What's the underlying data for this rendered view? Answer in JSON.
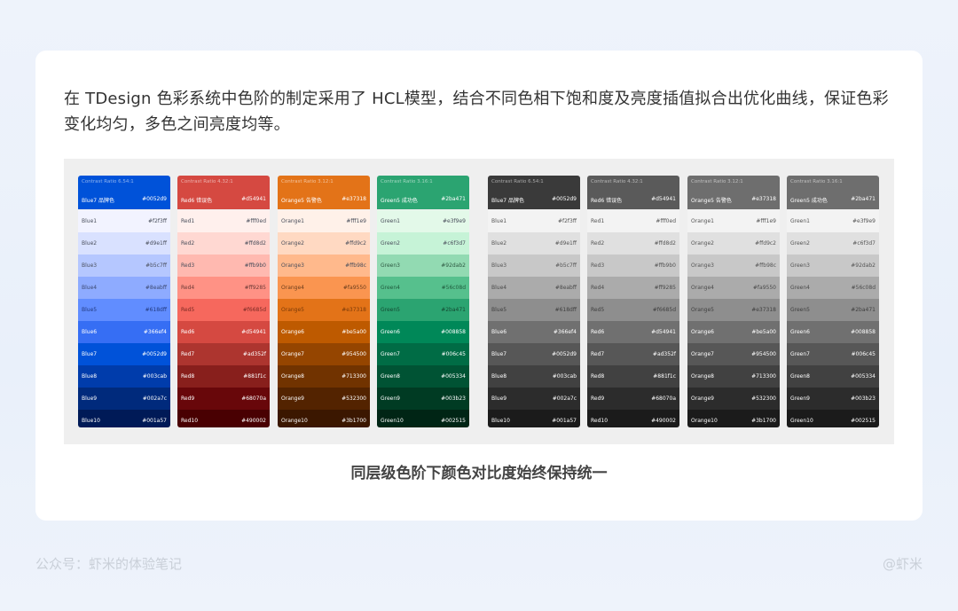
{
  "intro_text": "在 TDesign 色彩系统中色阶的制定采用了 HCL模型，结合不同色相下饱和度及亮度插值拟合出优化曲线，保证色彩变化均匀，多色之间亮度均等。",
  "caption": "同层级色阶下颜色对比度始终保持统一",
  "footer": {
    "left": "公众号：虾米的体验笔记",
    "right": "@虾米"
  },
  "palettes": [
    {
      "ratio": "Contrast Ratio 6.54:1",
      "subtitle": "Blue7 品牌色",
      "hex": "#0052d9",
      "header_color": "#0052d9",
      "rows": [
        {
          "name": "Blue1",
          "hex": "#f2f3ff",
          "bg": "#f2f3ff",
          "fg": "#4a4f5c"
        },
        {
          "name": "Blue2",
          "hex": "#d9e1ff",
          "bg": "#d9e1ff",
          "fg": "#4a4f5c"
        },
        {
          "name": "Blue3",
          "hex": "#b5c7ff",
          "bg": "#b5c7ff",
          "fg": "#4a4f5c"
        },
        {
          "name": "Blue4",
          "hex": "#8eabff",
          "bg": "#8eabff",
          "fg": "#3d4a73"
        },
        {
          "name": "Blue5",
          "hex": "#618dff",
          "bg": "#618dff",
          "fg": "#223a80"
        },
        {
          "name": "Blue6",
          "hex": "#366ef4",
          "bg": "#366ef4",
          "fg": "#ffffff"
        },
        {
          "name": "Blue7",
          "hex": "#0052d9",
          "bg": "#0052d9",
          "fg": "#ffffff"
        },
        {
          "name": "Blue8",
          "hex": "#003cab",
          "bg": "#003cab",
          "fg": "#ffffff"
        },
        {
          "name": "Blue9",
          "hex": "#002a7c",
          "bg": "#002a7c",
          "fg": "#ffffff"
        },
        {
          "name": "Blue10",
          "hex": "#001a57",
          "bg": "#001a57",
          "fg": "#ffffff"
        }
      ]
    },
    {
      "ratio": "Contrast Ratio 4.32:1",
      "subtitle": "Red6 错误色",
      "hex": "#d54941",
      "header_color": "#d54941",
      "rows": [
        {
          "name": "Red1",
          "hex": "#fff0ed",
          "bg": "#fff0ed",
          "fg": "#4a4f5c"
        },
        {
          "name": "Red2",
          "hex": "#ffd8d2",
          "bg": "#ffd8d2",
          "fg": "#4a4f5c"
        },
        {
          "name": "Red3",
          "hex": "#ffb9b0",
          "bg": "#ffb9b0",
          "fg": "#4a4f5c"
        },
        {
          "name": "Red4",
          "hex": "#ff9285",
          "bg": "#ff9285",
          "fg": "#6b3a36"
        },
        {
          "name": "Red5",
          "hex": "#f6685d",
          "bg": "#f6685d",
          "fg": "#7a2a24"
        },
        {
          "name": "Red6",
          "hex": "#d54941",
          "bg": "#d54941",
          "fg": "#ffffff"
        },
        {
          "name": "Red7",
          "hex": "#ad352f",
          "bg": "#ad352f",
          "fg": "#ffffff"
        },
        {
          "name": "Red8",
          "hex": "#881f1c",
          "bg": "#881f1c",
          "fg": "#ffffff"
        },
        {
          "name": "Red9",
          "hex": "#68070a",
          "bg": "#68070a",
          "fg": "#ffffff"
        },
        {
          "name": "Red10",
          "hex": "#490002",
          "bg": "#490002",
          "fg": "#ffffff"
        }
      ]
    },
    {
      "ratio": "Contrast Ratio 3.12:1",
      "subtitle": "Orange5 告警色",
      "hex": "#e37318",
      "header_color": "#e37318",
      "rows": [
        {
          "name": "Orange1",
          "hex": "#fff1e9",
          "bg": "#fff1e9",
          "fg": "#4a4f5c"
        },
        {
          "name": "Orange2",
          "hex": "#ffd9c2",
          "bg": "#ffd9c2",
          "fg": "#4a4f5c"
        },
        {
          "name": "Orange3",
          "hex": "#ffb98c",
          "bg": "#ffb98c",
          "fg": "#4a4f5c"
        },
        {
          "name": "Orange4",
          "hex": "#fa9550",
          "bg": "#fa9550",
          "fg": "#6b3d1c"
        },
        {
          "name": "Orange5",
          "hex": "#e37318",
          "bg": "#e37318",
          "fg": "#7a3a08"
        },
        {
          "name": "Orange6",
          "hex": "#be5a00",
          "bg": "#be5a00",
          "fg": "#ffffff"
        },
        {
          "name": "Orange7",
          "hex": "#954500",
          "bg": "#954500",
          "fg": "#ffffff"
        },
        {
          "name": "Orange8",
          "hex": "#713300",
          "bg": "#713300",
          "fg": "#ffffff"
        },
        {
          "name": "Orange9",
          "hex": "#532300",
          "bg": "#532300",
          "fg": "#ffffff"
        },
        {
          "name": "Orange10",
          "hex": "#3b1700",
          "bg": "#3b1700",
          "fg": "#ffffff"
        }
      ]
    },
    {
      "ratio": "Contrast Ratio 3.16:1",
      "subtitle": "Green5 成功色",
      "hex": "#2ba471",
      "header_color": "#2ba471",
      "rows": [
        {
          "name": "Green1",
          "hex": "#e3f9e9",
          "bg": "#e3f9e9",
          "fg": "#4a4f5c"
        },
        {
          "name": "Green2",
          "hex": "#c6f3d7",
          "bg": "#c6f3d7",
          "fg": "#4a4f5c"
        },
        {
          "name": "Green3",
          "hex": "#92dab2",
          "bg": "#92dab2",
          "fg": "#2f5a43"
        },
        {
          "name": "Green4",
          "hex": "#56c08d",
          "bg": "#56c08d",
          "fg": "#1f5a3d"
        },
        {
          "name": "Green5",
          "hex": "#2ba471",
          "bg": "#2ba471",
          "fg": "#134a32"
        },
        {
          "name": "Green6",
          "hex": "#008858",
          "bg": "#008858",
          "fg": "#ffffff"
        },
        {
          "name": "Green7",
          "hex": "#006c45",
          "bg": "#006c45",
          "fg": "#ffffff"
        },
        {
          "name": "Green8",
          "hex": "#005334",
          "bg": "#005334",
          "fg": "#ffffff"
        },
        {
          "name": "Green9",
          "hex": "#003b23",
          "bg": "#003b23",
          "fg": "#ffffff"
        },
        {
          "name": "Green10",
          "hex": "#002515",
          "bg": "#002515",
          "fg": "#ffffff"
        }
      ]
    },
    {
      "ratio": "Contrast Ratio 6.54:1",
      "subtitle": "Blue7 品牌色",
      "hex": "#0052d9",
      "header_color": "#3a3a3a",
      "rows": [
        {
          "name": "Blue1",
          "hex": "#f2f3ff",
          "bg": "#f3f3f3",
          "fg": "#555555"
        },
        {
          "name": "Blue2",
          "hex": "#d9e1ff",
          "bg": "#e0e0e0",
          "fg": "#555555"
        },
        {
          "name": "Blue3",
          "hex": "#b5c7ff",
          "bg": "#c8c8c8",
          "fg": "#555555"
        },
        {
          "name": "Blue4",
          "hex": "#8eabff",
          "bg": "#ababab",
          "fg": "#4a4a4a"
        },
        {
          "name": "Blue5",
          "hex": "#618dff",
          "bg": "#8e8e8e",
          "fg": "#3f3f3f"
        },
        {
          "name": "Blue6",
          "hex": "#366ef4",
          "bg": "#707070",
          "fg": "#ffffff"
        },
        {
          "name": "Blue7",
          "hex": "#0052d9",
          "bg": "#575757",
          "fg": "#ffffff"
        },
        {
          "name": "Blue8",
          "hex": "#003cab",
          "bg": "#414141",
          "fg": "#ffffff"
        },
        {
          "name": "Blue9",
          "hex": "#002a7c",
          "bg": "#2c2c2c",
          "fg": "#ffffff"
        },
        {
          "name": "Blue10",
          "hex": "#001a57",
          "bg": "#1b1b1b",
          "fg": "#ffffff"
        }
      ]
    },
    {
      "ratio": "Contrast Ratio 4.32:1",
      "subtitle": "Red6 错误色",
      "hex": "#d54941",
      "header_color": "#5a5a5a",
      "rows": [
        {
          "name": "Red1",
          "hex": "#fff0ed",
          "bg": "#f3f3f3",
          "fg": "#555555"
        },
        {
          "name": "Red2",
          "hex": "#ffd8d2",
          "bg": "#e0e0e0",
          "fg": "#555555"
        },
        {
          "name": "Red3",
          "hex": "#ffb9b0",
          "bg": "#c8c8c8",
          "fg": "#555555"
        },
        {
          "name": "Red4",
          "hex": "#ff9285",
          "bg": "#ababab",
          "fg": "#4a4a4a"
        },
        {
          "name": "Red5",
          "hex": "#f6685d",
          "bg": "#8e8e8e",
          "fg": "#3f3f3f"
        },
        {
          "name": "Red6",
          "hex": "#d54941",
          "bg": "#707070",
          "fg": "#ffffff"
        },
        {
          "name": "Red7",
          "hex": "#ad352f",
          "bg": "#575757",
          "fg": "#ffffff"
        },
        {
          "name": "Red8",
          "hex": "#881f1c",
          "bg": "#414141",
          "fg": "#ffffff"
        },
        {
          "name": "Red9",
          "hex": "#68070a",
          "bg": "#2c2c2c",
          "fg": "#ffffff"
        },
        {
          "name": "Red10",
          "hex": "#490002",
          "bg": "#1b1b1b",
          "fg": "#ffffff"
        }
      ]
    },
    {
      "ratio": "Contrast Ratio 3.12:1",
      "subtitle": "Orange5 告警色",
      "hex": "#e37318",
      "header_color": "#6e6e6e",
      "rows": [
        {
          "name": "Orange1",
          "hex": "#fff1e9",
          "bg": "#f3f3f3",
          "fg": "#555555"
        },
        {
          "name": "Orange2",
          "hex": "#ffd9c2",
          "bg": "#e0e0e0",
          "fg": "#555555"
        },
        {
          "name": "Orange3",
          "hex": "#ffb98c",
          "bg": "#c8c8c8",
          "fg": "#555555"
        },
        {
          "name": "Orange4",
          "hex": "#fa9550",
          "bg": "#ababab",
          "fg": "#4a4a4a"
        },
        {
          "name": "Orange5",
          "hex": "#e37318",
          "bg": "#8e8e8e",
          "fg": "#3f3f3f"
        },
        {
          "name": "Orange6",
          "hex": "#be5a00",
          "bg": "#707070",
          "fg": "#ffffff"
        },
        {
          "name": "Orange7",
          "hex": "#954500",
          "bg": "#575757",
          "fg": "#ffffff"
        },
        {
          "name": "Orange8",
          "hex": "#713300",
          "bg": "#414141",
          "fg": "#ffffff"
        },
        {
          "name": "Orange9",
          "hex": "#532300",
          "bg": "#2c2c2c",
          "fg": "#ffffff"
        },
        {
          "name": "Orange10",
          "hex": "#3b1700",
          "bg": "#1b1b1b",
          "fg": "#ffffff"
        }
      ]
    },
    {
      "ratio": "Contrast Ratio 3.16:1",
      "subtitle": "Green5 成功色",
      "hex": "#2ba471",
      "header_color": "#6e6e6e",
      "rows": [
        {
          "name": "Green1",
          "hex": "#e3f9e9",
          "bg": "#f3f3f3",
          "fg": "#555555"
        },
        {
          "name": "Green2",
          "hex": "#c6f3d7",
          "bg": "#e0e0e0",
          "fg": "#555555"
        },
        {
          "name": "Green3",
          "hex": "#92dab2",
          "bg": "#c8c8c8",
          "fg": "#555555"
        },
        {
          "name": "Green4",
          "hex": "#56c08d",
          "bg": "#ababab",
          "fg": "#4a4a4a"
        },
        {
          "name": "Green5",
          "hex": "#2ba471",
          "bg": "#8e8e8e",
          "fg": "#3f3f3f"
        },
        {
          "name": "Green6",
          "hex": "#008858",
          "bg": "#707070",
          "fg": "#ffffff"
        },
        {
          "name": "Green7",
          "hex": "#006c45",
          "bg": "#575757",
          "fg": "#ffffff"
        },
        {
          "name": "Green8",
          "hex": "#005334",
          "bg": "#414141",
          "fg": "#ffffff"
        },
        {
          "name": "Green9",
          "hex": "#003b23",
          "bg": "#2c2c2c",
          "fg": "#ffffff"
        },
        {
          "name": "Green10",
          "hex": "#002515",
          "bg": "#1b1b1b",
          "fg": "#ffffff"
        }
      ]
    }
  ]
}
